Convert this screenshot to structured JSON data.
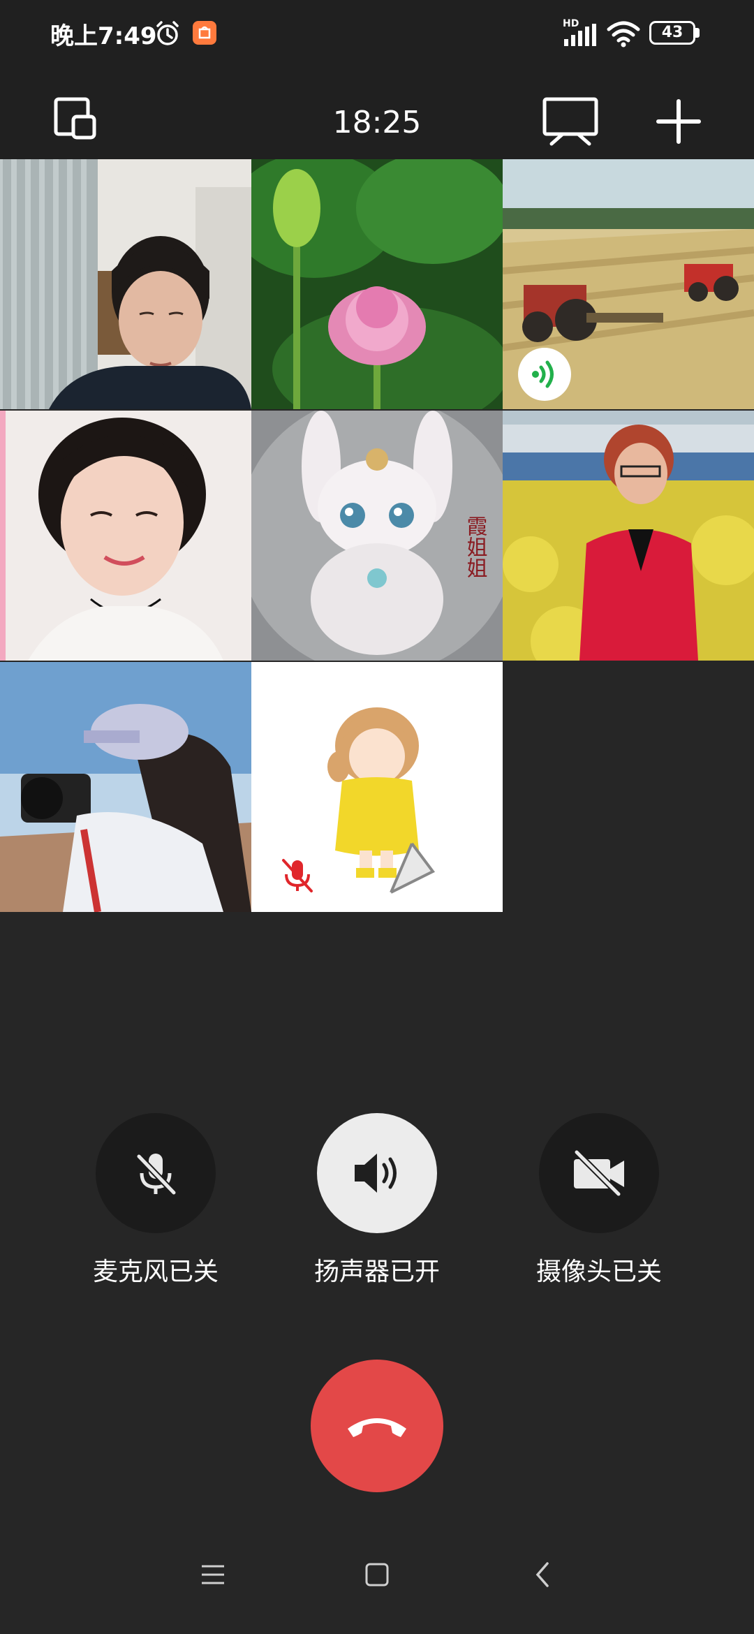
{
  "status_bar": {
    "time": "晚上7:49",
    "network_badge": "HD",
    "battery": "43",
    "icons": [
      "alarm-icon",
      "app-notification-icon",
      "signal-icon",
      "wifi-icon",
      "battery-icon"
    ]
  },
  "call": {
    "timer": "18:25",
    "left_icon": "minimize-window-icon",
    "right_icons": [
      "screen-share-icon",
      "add-participant-icon"
    ]
  },
  "participants": [
    {
      "id": "p1",
      "image": "woman-portrait-indoor",
      "muted": false,
      "speaking": false
    },
    {
      "id": "p2",
      "image": "lotus-flower",
      "muted": false,
      "speaking": false
    },
    {
      "id": "p3",
      "image": "tractor-painting",
      "muted": false,
      "speaking": true
    },
    {
      "id": "p4",
      "image": "smiling-woman-portrait",
      "muted": false,
      "speaking": false
    },
    {
      "id": "p5",
      "image": "rabbit-figurine",
      "avatar_text": "霞姐姐",
      "muted": false,
      "speaking": false
    },
    {
      "id": "p6",
      "image": "woman-in-flower-field",
      "muted": false,
      "speaking": false
    },
    {
      "id": "p7",
      "image": "photographer-with-camera",
      "muted": false,
      "speaking": false
    },
    {
      "id": "p8",
      "image": "cartoon-girl-raincoat",
      "muted": true,
      "speaking": false
    }
  ],
  "controls": {
    "mic_label": "麦克风已关",
    "speaker_label": "扬声器已开",
    "camera_label": "摄像头已关"
  },
  "colors": {
    "background": "#262626",
    "hangup": "#e34848",
    "speaking_indicator": "#22b04b",
    "muted_indicator": "#e0262b"
  }
}
